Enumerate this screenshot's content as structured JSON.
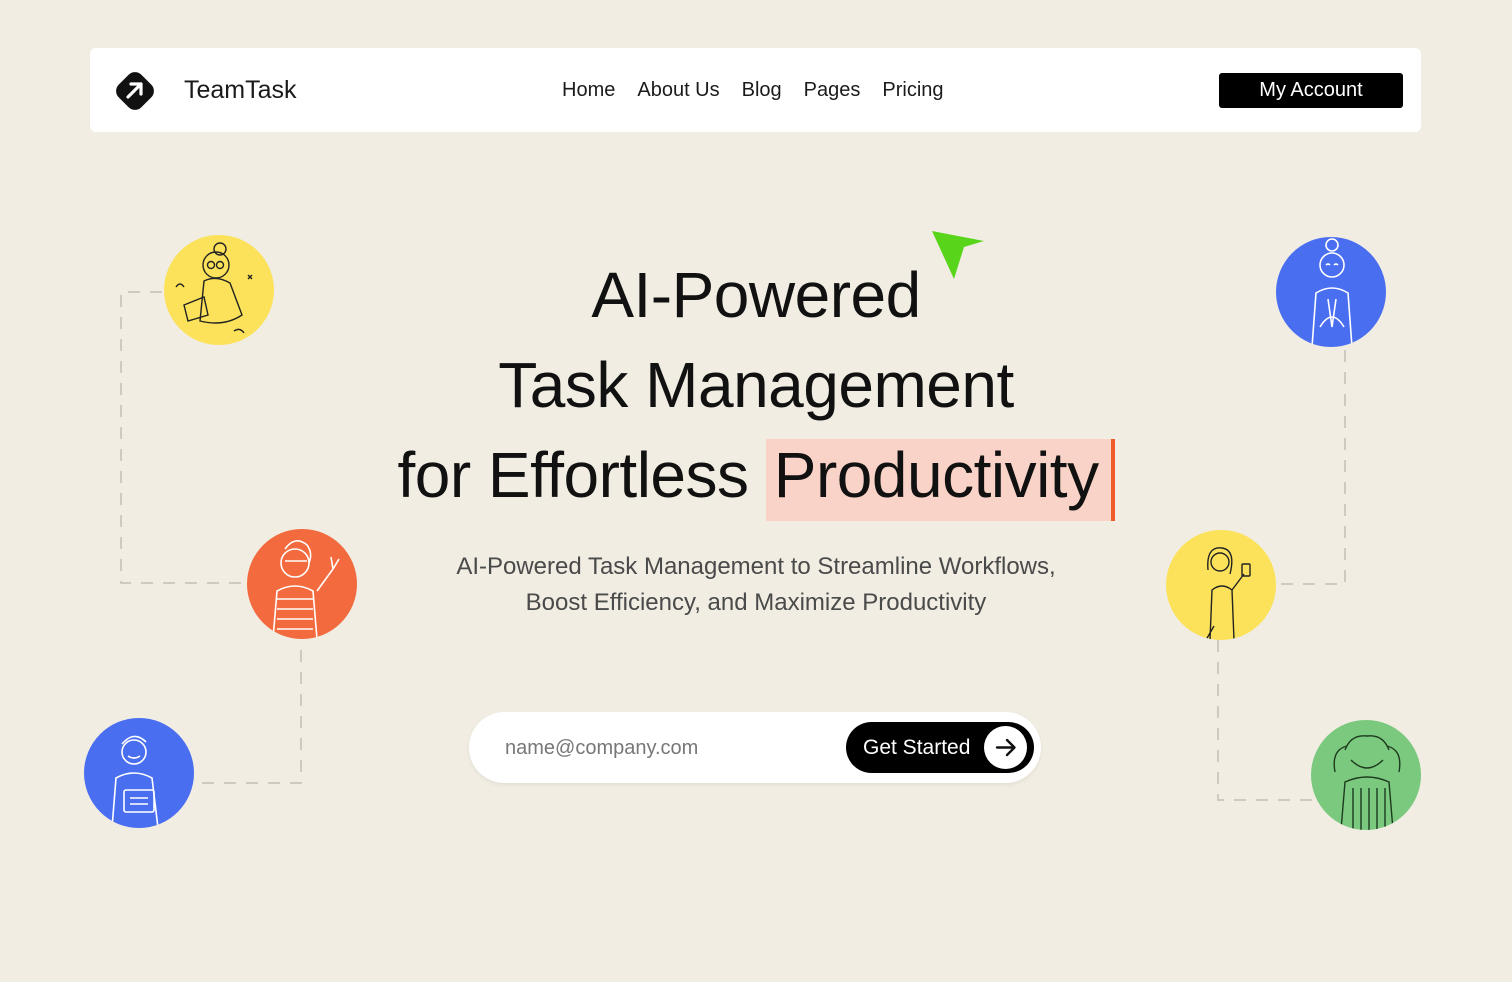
{
  "nav": {
    "brand": "TeamTask",
    "logo_icon": "arrow-up-right-icon",
    "items": [
      {
        "label": "Home"
      },
      {
        "label": "About Us"
      },
      {
        "label": "Blog"
      },
      {
        "label": "Pages"
      },
      {
        "label": "Pricing"
      }
    ],
    "account_label": "My Account"
  },
  "hero": {
    "line1": "AI-Powered",
    "line2": "Task Management",
    "line3_prefix": "for Effortless",
    "line3_highlight": "Productivity",
    "subtitle_line1": "AI-Powered Task Management to Streamline Workflows,",
    "subtitle_line2": "Boost Efficiency, and Maximize Productivity",
    "cursor_icon": "pointer-cursor-icon"
  },
  "signup": {
    "email_placeholder": "name@company.com",
    "cta_label": "Get Started",
    "cta_icon": "arrow-right-icon"
  },
  "avatars": [
    {
      "name": "reading-person",
      "color": "#fbe25a"
    },
    {
      "name": "peace-sign-person",
      "color": "#f26a3d"
    },
    {
      "name": "person-with-laptop",
      "color": "#4a6ef0"
    },
    {
      "name": "praying-person",
      "color": "#4a6ef0"
    },
    {
      "name": "person-with-phone",
      "color": "#fbe25a"
    },
    {
      "name": "person-hands-on-head",
      "color": "#7bc97f"
    }
  ],
  "colors": {
    "background": "#f1ede3",
    "highlight": "#f9d3c8",
    "caret": "#ef5a2d",
    "cursor": "#58d51a"
  }
}
